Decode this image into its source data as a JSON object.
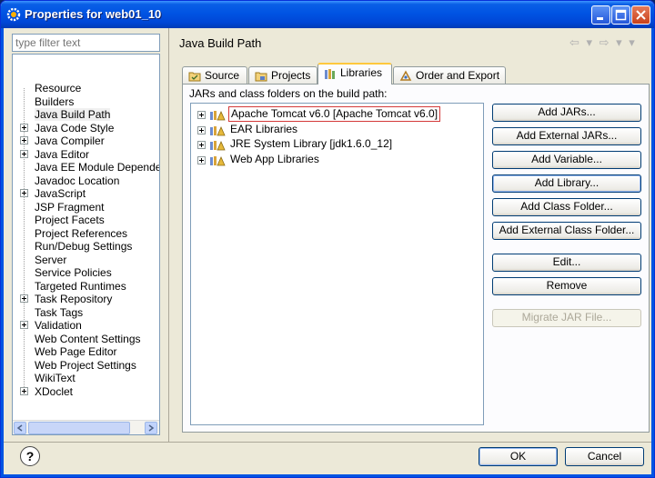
{
  "window": {
    "title": "Properties for web01_10"
  },
  "filter": {
    "placeholder": "type filter text"
  },
  "tree": {
    "items": [
      {
        "label": "Resource",
        "expandable": false
      },
      {
        "label": "Builders",
        "expandable": false
      },
      {
        "label": "Java Build Path",
        "expandable": false,
        "selected": true
      },
      {
        "label": "Java Code Style",
        "expandable": true
      },
      {
        "label": "Java Compiler",
        "expandable": true
      },
      {
        "label": "Java Editor",
        "expandable": true
      },
      {
        "label": "Java EE Module Depende",
        "expandable": false
      },
      {
        "label": "Javadoc Location",
        "expandable": false
      },
      {
        "label": "JavaScript",
        "expandable": true
      },
      {
        "label": "JSP Fragment",
        "expandable": false
      },
      {
        "label": "Project Facets",
        "expandable": false
      },
      {
        "label": "Project References",
        "expandable": false
      },
      {
        "label": "Run/Debug Settings",
        "expandable": false
      },
      {
        "label": "Server",
        "expandable": false
      },
      {
        "label": "Service Policies",
        "expandable": false
      },
      {
        "label": "Targeted Runtimes",
        "expandable": false
      },
      {
        "label": "Task Repository",
        "expandable": true
      },
      {
        "label": "Task Tags",
        "expandable": false
      },
      {
        "label": "Validation",
        "expandable": true
      },
      {
        "label": "Web Content Settings",
        "expandable": false
      },
      {
        "label": "Web Page Editor",
        "expandable": false
      },
      {
        "label": "Web Project Settings",
        "expandable": false
      },
      {
        "label": "WikiText",
        "expandable": false
      },
      {
        "label": "XDoclet",
        "expandable": true
      }
    ]
  },
  "page": {
    "title": "Java Build Path",
    "nav": "⇦ ▾ ⇨ ▾ ▾"
  },
  "tabs": [
    {
      "label": "Source",
      "icon": "source-folder-icon"
    },
    {
      "label": "Projects",
      "icon": "projects-icon"
    },
    {
      "label": "Libraries",
      "icon": "libraries-icon",
      "active": true
    },
    {
      "label": "Order and Export",
      "icon": "order-export-icon"
    }
  ],
  "libraries": {
    "label": "JARs and class folders on the build path:",
    "items": [
      {
        "label": "Apache Tomcat v6.0 [Apache Tomcat v6.0]",
        "selected": true
      },
      {
        "label": "EAR Libraries"
      },
      {
        "label": "JRE System Library [jdk1.6.0_12]"
      },
      {
        "label": "Web App Libraries"
      }
    ]
  },
  "buttons": {
    "add_jars": "Add JARs...",
    "add_external_jars": "Add External JARs...",
    "add_variable": "Add Variable...",
    "add_library": "Add Library...",
    "add_class_folder": "Add Class Folder...",
    "add_external_class_folder": "Add External Class Folder...",
    "edit": "Edit...",
    "remove": "Remove",
    "migrate_jar": "Migrate JAR File..."
  },
  "dialog": {
    "ok": "OK",
    "cancel": "Cancel",
    "help": "?"
  },
  "colors": {
    "titlebar": "#0054e3",
    "selection_outline": "#d43a3a",
    "tab_highlight": "#ffc83c"
  }
}
